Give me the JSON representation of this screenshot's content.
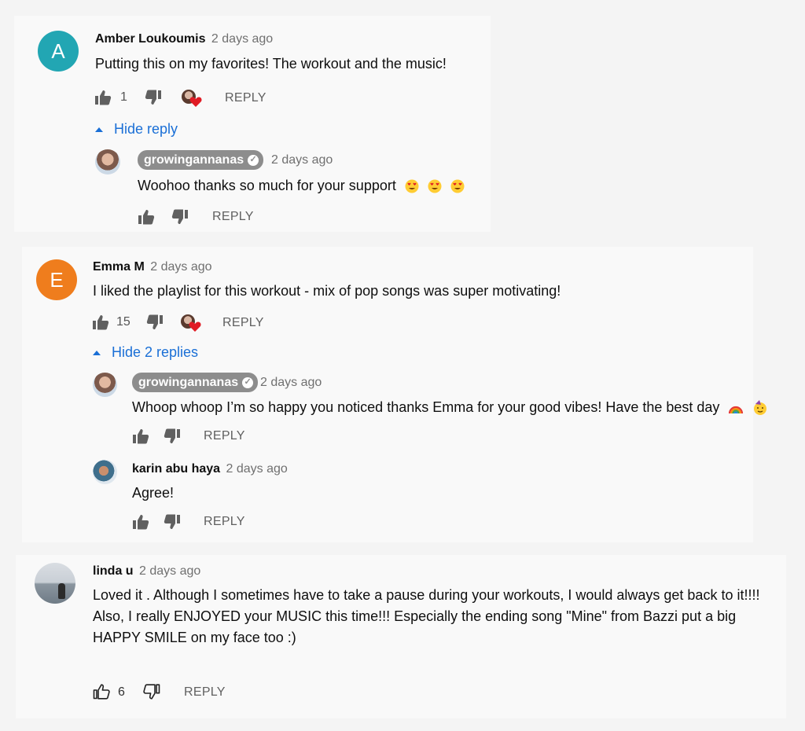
{
  "comments": [
    {
      "avatar_letter": "A",
      "avatar_color": "#22a6b3",
      "author": "Amber Loukoumis",
      "time": "2 days ago",
      "text": "Putting this on my favorites! The workout and the music!",
      "likes": "1",
      "reply_label": "REPLY",
      "toggle_label": "Hide reply",
      "replies": [
        {
          "author": "growingannanas",
          "verified": true,
          "time": "2 days ago",
          "text": "Woohoo thanks so much for your support",
          "emoji": [
            "heart-eyes-emoji",
            "heart-eyes-emoji",
            "heart-eyes-emoji"
          ],
          "reply_label": "REPLY"
        }
      ]
    },
    {
      "avatar_letter": "E",
      "avatar_color": "#ef7d1d",
      "author": "Emma M",
      "time": "2 days ago",
      "text": "I liked the playlist for this workout - mix of pop songs was super motivating!",
      "likes": "15",
      "reply_label": "REPLY",
      "toggle_label": "Hide 2 replies",
      "replies": [
        {
          "author": "growingannanas",
          "verified": true,
          "time": "2 days ago",
          "text": "Whoop whoop I’m so happy you noticed thanks Emma for your good vibes! Have the best day",
          "emoji": [
            "rainbow-emoji",
            "party-face-emoji"
          ],
          "reply_label": "REPLY"
        },
        {
          "author": "karin abu haya",
          "verified": false,
          "time": "2 days ago",
          "text": "Agree!",
          "reply_label": "REPLY"
        }
      ]
    },
    {
      "author": "linda u",
      "time": "2 days ago",
      "text_line1": "Loved it . Although I sometimes have to take a pause during your workouts, I would always get back to it!!!!",
      "text_line2": "Also, I really ENJOYED your MUSIC this time!!! Especially the ending song \"Mine\" from Bazzi put a big HAPPY SMILE on my face too :)",
      "likes": "6",
      "reply_label": "REPLY"
    }
  ],
  "icons": {
    "like": "thumbs-up-icon",
    "dislike": "thumbs-down-icon",
    "creator_heart": "creator-heart-badge"
  },
  "colors": {
    "link_blue": "#1a6fd6",
    "chip_gray": "#8d8d8d",
    "heart_red": "#e01b24"
  }
}
